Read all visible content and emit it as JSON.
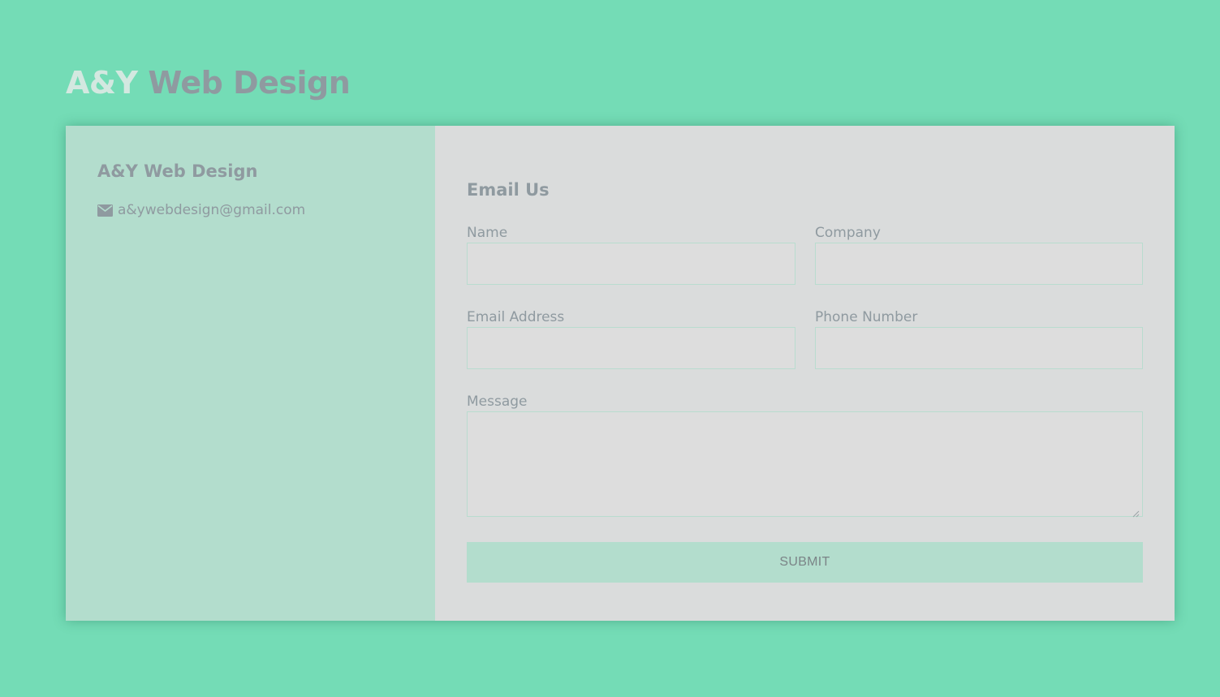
{
  "header": {
    "brand_part_1": "A&Y",
    "brand_part_2": "Web Design"
  },
  "info_panel": {
    "title": "A&Y Web Design",
    "email": "a&ywebdesign@gmail.com",
    "email_icon": "envelope-icon"
  },
  "form": {
    "title": "Email Us",
    "fields": {
      "name": {
        "label": "Name",
        "value": ""
      },
      "company": {
        "label": "Company",
        "value": ""
      },
      "email": {
        "label": "Email Address",
        "value": ""
      },
      "phone": {
        "label": "Phone Number",
        "value": ""
      },
      "message": {
        "label": "Message",
        "value": ""
      }
    },
    "submit_label": "SUBMIT"
  },
  "colors": {
    "background": "#74dcb6",
    "info_panel": "#b3ddcd",
    "form_panel": "#dadcdc",
    "text_muted": "#8f9aa0",
    "button": "#b3ddcd"
  }
}
